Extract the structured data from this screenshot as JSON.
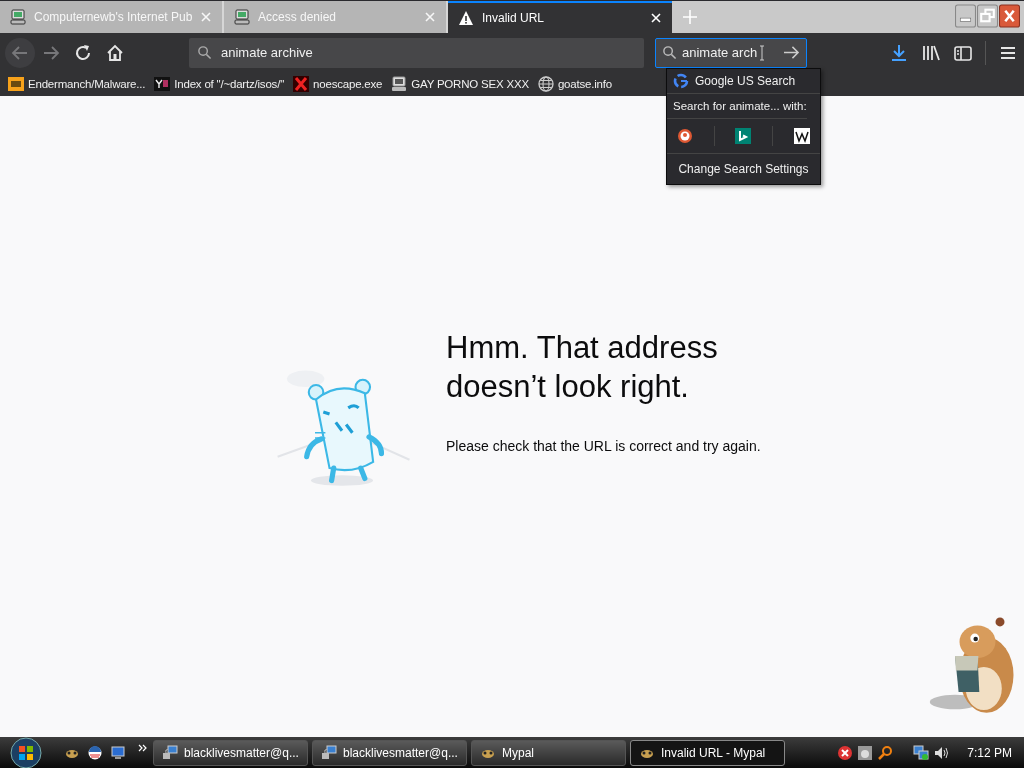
{
  "tabs": [
    {
      "title": "Computernewb's Internet Pub",
      "kind": "computer",
      "selected": false
    },
    {
      "title": "Access denied",
      "kind": "computer",
      "selected": false
    },
    {
      "title": "Invalid URL",
      "kind": "warning",
      "selected": true
    }
  ],
  "toolbar": {
    "address": "animate archive",
    "search": "animate arch"
  },
  "bookmarks": [
    {
      "title": "Endermanch/Malware...",
      "kind": "letters"
    },
    {
      "title": "Index of \"/~dartz/isos/\"",
      "kind": "tile"
    },
    {
      "title": "noescape.exe",
      "kind": "cross"
    },
    {
      "title": "GAY PORNO SEX XXX",
      "kind": "computer"
    },
    {
      "title": "goatse.info",
      "kind": "globe"
    }
  ],
  "search_popup": {
    "suggestion": "Google US Search",
    "header": "Search for animate... with:",
    "settings": "Change Search Settings"
  },
  "error": {
    "title": "Hmm. That address doesn’t look right.",
    "message": "Please check that the URL is correct and try again."
  },
  "taskbar": {
    "buttons": [
      {
        "label": "blacklivesmatter@q...",
        "kind": "network",
        "selected": false
      },
      {
        "label": "blacklivesmatter@q...",
        "kind": "network",
        "selected": false
      },
      {
        "label": "Mypal",
        "kind": "animal",
        "selected": false
      },
      {
        "label": "Invalid URL - Mypal",
        "kind": "animal",
        "selected": true
      }
    ],
    "clock": "7:12 PM"
  }
}
